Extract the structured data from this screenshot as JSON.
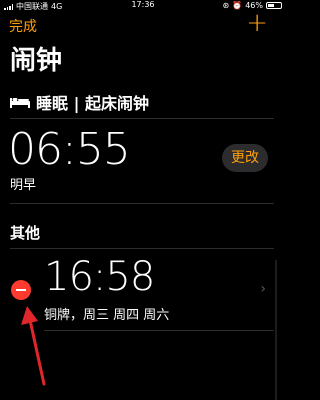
{
  "status_bar": {
    "carrier": "中国联通",
    "network": "4G",
    "time": "17:36",
    "battery": "46%",
    "battery_level": 0.46
  },
  "nav": {
    "edit_label": "完成",
    "add_label": "+"
  },
  "page_title": "闹钟",
  "sleep": {
    "icon": "bed-icon",
    "label": "睡眠 | 起床闹钟"
  },
  "wake_alarm": {
    "time": "06:55",
    "subtitle": "明早",
    "change_label": "更改"
  },
  "section_other": "其他",
  "other_alarm": {
    "time": "16:58",
    "subtitle": "铜牌，周三 周四 周六"
  },
  "colors": {
    "accent": "#ff9f0a",
    "delete": "#ff3b30",
    "annotation_arrow": "#e0262a"
  }
}
